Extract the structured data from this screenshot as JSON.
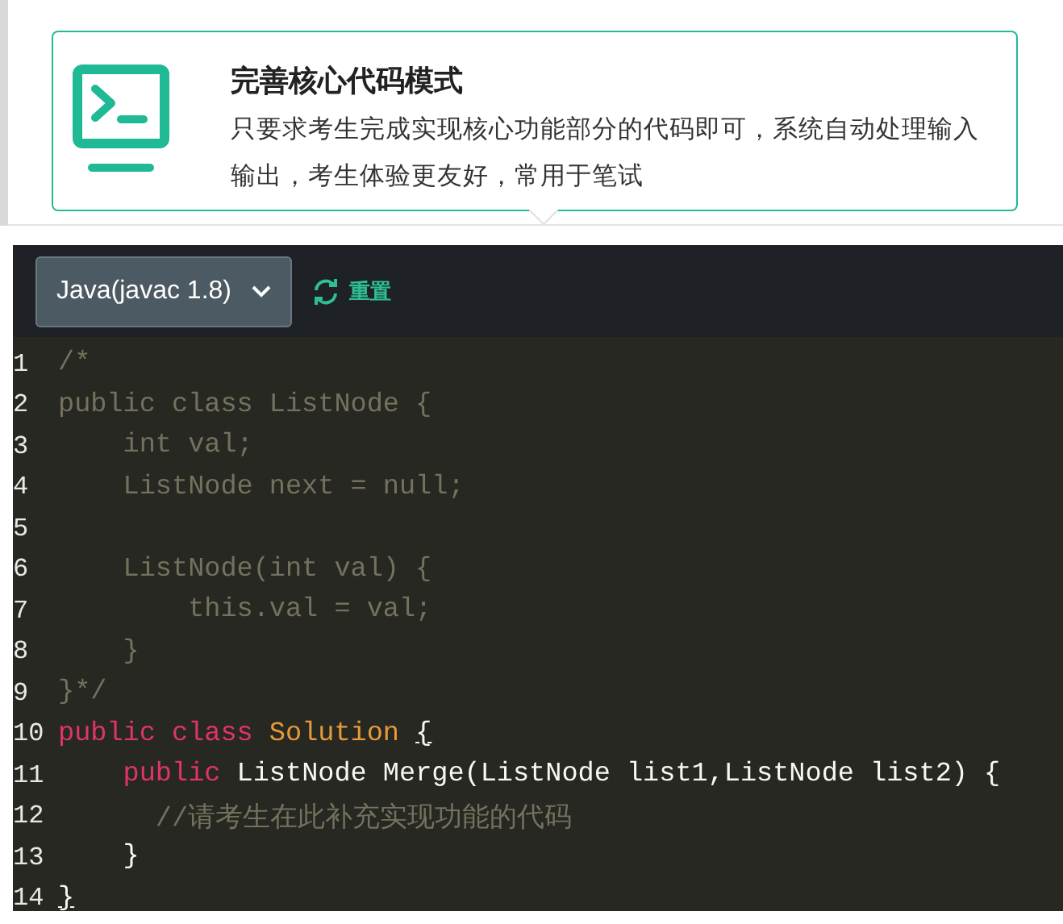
{
  "mode_card": {
    "title": "完善核心代码模式",
    "description": "只要求考生完成实现核心功能部分的代码即可，系统自动处理输入输出，考生体验更友好，常用于笔试"
  },
  "toolbar": {
    "language": "Java(javac 1.8)",
    "reset": "重置"
  },
  "code_lines": [
    {
      "number": "1",
      "tokens": [
        {
          "kind": "comment",
          "text": "/*"
        }
      ]
    },
    {
      "number": "2",
      "tokens": [
        {
          "kind": "comment",
          "text": "public class ListNode {"
        }
      ]
    },
    {
      "number": "3",
      "tokens": [
        {
          "kind": "comment",
          "text": "    int val;"
        }
      ]
    },
    {
      "number": "4",
      "tokens": [
        {
          "kind": "comment",
          "text": "    ListNode next = null;"
        }
      ]
    },
    {
      "number": "5"
    },
    {
      "number": "6",
      "tokens": [
        {
          "kind": "comment",
          "text": "    ListNode(int val) {"
        }
      ]
    },
    {
      "number": "7",
      "tokens": [
        {
          "kind": "comment",
          "text": "        this.val = val;"
        }
      ]
    },
    {
      "number": "8",
      "tokens": [
        {
          "kind": "comment",
          "text": "    }"
        }
      ]
    },
    {
      "number": "9",
      "tokens": [
        {
          "kind": "comment",
          "text": "}*/"
        }
      ]
    },
    {
      "number": "10",
      "tokens": [
        {
          "kind": "keyword",
          "text": "public class "
        },
        {
          "kind": "class",
          "text": "Solution "
        },
        {
          "kind": "bracket",
          "text": "{"
        }
      ]
    },
    {
      "number": "11",
      "tokens": [
        {
          "kind": "keyword",
          "text": "    public"
        },
        {
          "kind": "plain",
          "text": " ListNode Merge(ListNode list1,ListNode list2) {"
        }
      ]
    },
    {
      "number": "12",
      "tokens": [
        {
          "kind": "comment",
          "text": "      //请考生在此补充实现功能的代码"
        }
      ]
    },
    {
      "number": "13",
      "tokens": [
        {
          "kind": "plain",
          "text": "    }"
        }
      ]
    },
    {
      "number": "14",
      "tokens": [
        {
          "kind": "bracket",
          "text": "}"
        }
      ]
    }
  ]
}
